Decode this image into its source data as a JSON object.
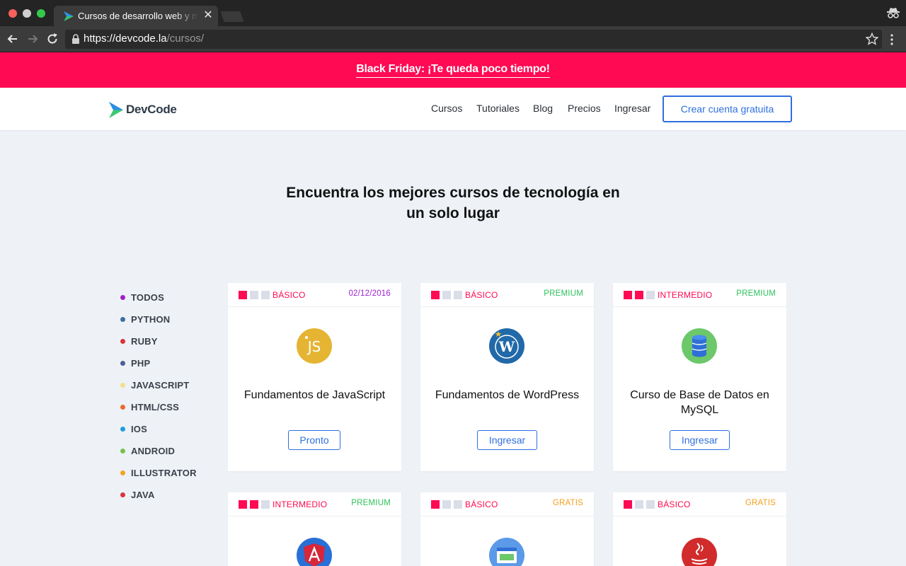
{
  "browser": {
    "tab_title": "Cursos de desarrollo web y móviles",
    "close_glyph": "✕",
    "url_host": "https://devcode.la",
    "url_path": "/cursos/",
    "icons": [
      "favicon-icon",
      "incognito-icon",
      "back-arrow-icon",
      "forward-arrow-icon",
      "reload-icon",
      "lock-icon",
      "star-icon",
      "menu-icon"
    ]
  },
  "promo": {
    "text": "Black Friday: ¡Te queda poco tiempo!",
    "color": "#ff0a53"
  },
  "header": {
    "logo_text": "DevCode",
    "nav": [
      "Cursos",
      "Tutoriales",
      "Blog",
      "Precios",
      "Ingresar"
    ],
    "cta": "Crear cuenta gratuita",
    "accent": "#2f6fe0"
  },
  "hero": {
    "line1": "Encuentra los mejores cursos de tecnología en",
    "line2": "un solo lugar"
  },
  "categories": [
    {
      "label": "TODOS",
      "color": "#a020c8"
    },
    {
      "label": "PYTHON",
      "color": "#3b6ea5"
    },
    {
      "label": "RUBY",
      "color": "#d8333a"
    },
    {
      "label": "PHP",
      "color": "#4d5f95"
    },
    {
      "label": "JAVASCRIPT",
      "color": "#f3e08a"
    },
    {
      "label": "HTML/CSS",
      "color": "#ec6a2c"
    },
    {
      "label": "IOS",
      "color": "#1e9ee2"
    },
    {
      "label": "ANDROID",
      "color": "#79c24a"
    },
    {
      "label": "ILLUSTRATOR",
      "color": "#f3a421"
    },
    {
      "label": "JAVA",
      "color": "#d6373a"
    }
  ],
  "courses": [
    {
      "level": "BÁSICO",
      "level_bars": 1,
      "tag": "02/12/2016",
      "tag_type": "date",
      "icon": "javascript-icon",
      "title": "Fundamentos de JavaScript",
      "button": "Pronto"
    },
    {
      "level": "BÁSICO",
      "level_bars": 1,
      "tag": "PREMIUM",
      "tag_type": "premium",
      "icon": "wordpress-icon",
      "title": "Fundamentos de WordPress",
      "button": "Ingresar"
    },
    {
      "level": "INTERMEDIO",
      "level_bars": 2,
      "tag": "PREMIUM",
      "tag_type": "premium",
      "icon": "database-icon",
      "title": "Curso de Base de Datos en MySQL",
      "button": "Ingresar"
    },
    {
      "level": "INTERMEDIO",
      "level_bars": 2,
      "tag": "PREMIUM",
      "tag_type": "premium",
      "icon": "angular-icon",
      "title": "",
      "button": ""
    },
    {
      "level": "BÁSICO",
      "level_bars": 1,
      "tag": "GRATIS",
      "tag_type": "gratis",
      "icon": "browser-window-icon",
      "title": "",
      "button": ""
    },
    {
      "level": "BÁSICO",
      "level_bars": 1,
      "tag": "GRATIS",
      "tag_type": "gratis",
      "icon": "java-icon",
      "title": "",
      "button": ""
    }
  ]
}
